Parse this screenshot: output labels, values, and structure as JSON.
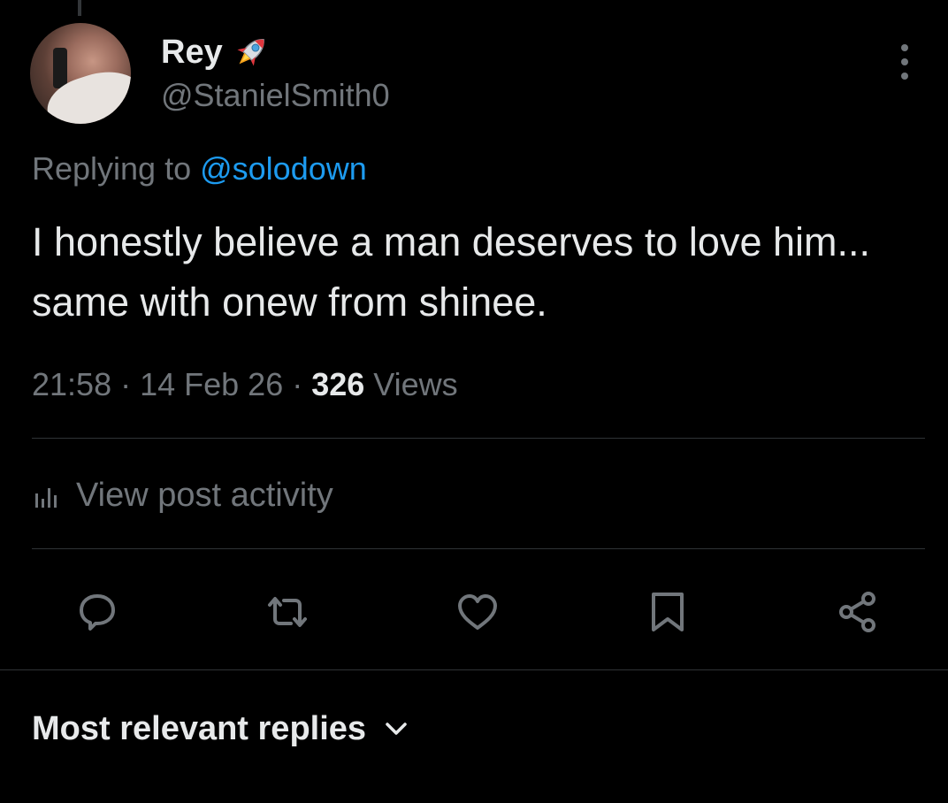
{
  "author": {
    "display_name": "Rey",
    "badge_emoji": "rocket-icon",
    "handle": "@StanielSmith0"
  },
  "reply_context": {
    "prefix": "Replying to ",
    "mention": "@solodown"
  },
  "tweet": {
    "text": "I honestly believe a man deserves to love him... same with onew from shinee.",
    "time": "21:58",
    "sep1": " · ",
    "date": "14 Feb 26",
    "sep2": " · ",
    "views_count": "326",
    "views_label": " Views"
  },
  "activity": {
    "label": "View post activity"
  },
  "actions": [
    "reply-icon",
    "repost-icon",
    "like-icon",
    "bookmark-icon",
    "share-icon"
  ],
  "replies_sort": {
    "label": "Most relevant replies"
  },
  "colors": {
    "background": "#000000",
    "primary_text": "#e7e9ea",
    "secondary_text": "#71767b",
    "accent": "#1d9bf0",
    "divider": "#2f3336"
  }
}
